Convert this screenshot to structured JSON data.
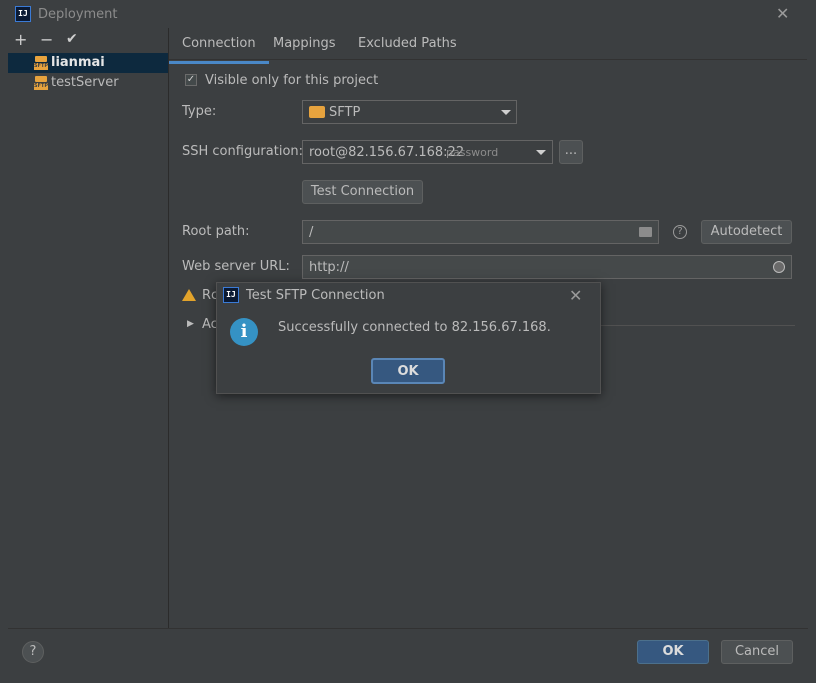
{
  "window": {
    "title": "Deployment"
  },
  "toolbar": {
    "add": "+",
    "remove": "−",
    "apply": "✔"
  },
  "servers": [
    {
      "name": "lianmai",
      "selected": true
    },
    {
      "name": "testServer",
      "selected": false
    }
  ],
  "tabs": [
    {
      "label": "Connection",
      "active": true
    },
    {
      "label": "Mappings",
      "active": false
    },
    {
      "label": "Excluded Paths",
      "active": false
    }
  ],
  "connection": {
    "visible_only_label": "Visible only for this project",
    "visible_only_checked": true,
    "type_label": "Type:",
    "type_value": "SFTP",
    "sftp_badge_text": "SFTP",
    "ssh_label": "SSH configuration:",
    "ssh_value": "root@82.156.67.168:22",
    "ssh_auth": "password",
    "ssh_more": "...",
    "test_button": "Test Connection",
    "root_label": "Root path:",
    "root_value": "/",
    "autodetect_button": "Autodetect",
    "web_label": "Web server URL:",
    "web_value": "http://",
    "warning_text": "Rc",
    "advanced_text": "Ac"
  },
  "modal": {
    "title": "Test SFTP Connection",
    "message": "Successfully connected to 82.156.67.168.",
    "ok": "OK"
  },
  "footer": {
    "help": "?",
    "ok": "OK",
    "cancel": "Cancel"
  },
  "icons": {
    "app": "intellij-icon",
    "close": "✕",
    "help": "?",
    "info": "i",
    "globe": "globe-icon",
    "folder": "folder-icon",
    "warning": "warning-icon",
    "expand": "▶"
  },
  "colors": {
    "background": "#3c3f41",
    "selection": "#0d293e",
    "accent": "#4a88c7",
    "primary_button": "#365880",
    "info": "#3592c4",
    "warning": "#e2a32b",
    "sftp": "#e7a33e"
  }
}
